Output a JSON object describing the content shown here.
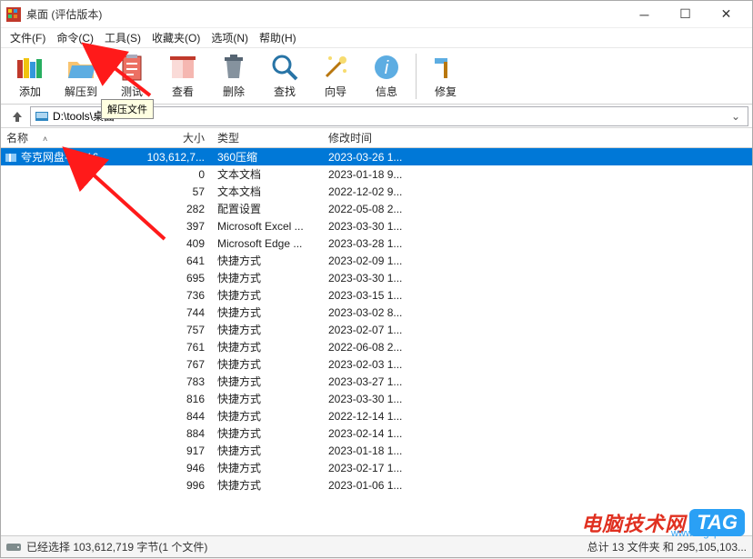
{
  "window": {
    "title": "桌面 (评估版本)"
  },
  "menu": {
    "file": "文件(F)",
    "command": "命令(C)",
    "tools": "工具(S)",
    "favorites": "收藏夹(O)",
    "options": "选项(N)",
    "help": "帮助(H)"
  },
  "toolbar": {
    "add": "添加",
    "extract": "解压到",
    "test": "测试",
    "view": "查看",
    "delete": "删除",
    "find": "查找",
    "wizard": "向导",
    "info": "信息",
    "repair": "修复"
  },
  "tooltip": {
    "extract": "解压文件"
  },
  "address": {
    "path": "D:\\tools\\桌面"
  },
  "headers": {
    "name": "名称",
    "size": "大小",
    "type": "类型",
    "date": "修改时间"
  },
  "files": [
    {
      "name": "夸克网盘-1.0.16...",
      "size": "103,612,7...",
      "type": "360压缩",
      "date": "2023-03-26 1...",
      "selected": true,
      "icon": "archive"
    },
    {
      "name": "",
      "size": "0",
      "type": "文本文档",
      "date": "2023-01-18 9..."
    },
    {
      "name": "",
      "size": "57",
      "type": "文本文档",
      "date": "2022-12-02 9..."
    },
    {
      "name": "",
      "size": "282",
      "type": "配置设置",
      "date": "2022-05-08 2..."
    },
    {
      "name": "",
      "size": "397",
      "type": "Microsoft Excel ...",
      "date": "2023-03-30 1..."
    },
    {
      "name": "",
      "size": "409",
      "type": "Microsoft Edge ...",
      "date": "2023-03-28 1..."
    },
    {
      "name": "",
      "size": "641",
      "type": "快捷方式",
      "date": "2023-02-09 1..."
    },
    {
      "name": "",
      "size": "695",
      "type": "快捷方式",
      "date": "2023-03-30 1..."
    },
    {
      "name": "",
      "size": "736",
      "type": "快捷方式",
      "date": "2023-03-15 1..."
    },
    {
      "name": "",
      "size": "744",
      "type": "快捷方式",
      "date": "2023-03-02 8..."
    },
    {
      "name": "",
      "size": "757",
      "type": "快捷方式",
      "date": "2023-02-07 1..."
    },
    {
      "name": "",
      "size": "761",
      "type": "快捷方式",
      "date": "2022-06-08 2..."
    },
    {
      "name": "",
      "size": "767",
      "type": "快捷方式",
      "date": "2023-02-03 1..."
    },
    {
      "name": "",
      "size": "783",
      "type": "快捷方式",
      "date": "2023-03-27 1..."
    },
    {
      "name": "",
      "size": "816",
      "type": "快捷方式",
      "date": "2023-03-30 1..."
    },
    {
      "name": "",
      "size": "844",
      "type": "快捷方式",
      "date": "2022-12-14 1..."
    },
    {
      "name": "",
      "size": "884",
      "type": "快捷方式",
      "date": "2023-02-14 1..."
    },
    {
      "name": "",
      "size": "917",
      "type": "快捷方式",
      "date": "2023-01-18 1..."
    },
    {
      "name": "",
      "size": "946",
      "type": "快捷方式",
      "date": "2023-02-17 1..."
    },
    {
      "name": "",
      "size": "996",
      "type": "快捷方式",
      "date": "2023-01-06 1..."
    }
  ],
  "status": {
    "left": "已经选择 103,612,719 字节(1 个文件)",
    "right": "总计 13 文件夹 和 295,105,103..."
  },
  "watermark": {
    "brand": "电脑技术网",
    "tag": "TAG",
    "url": "www.tagxp.com"
  }
}
